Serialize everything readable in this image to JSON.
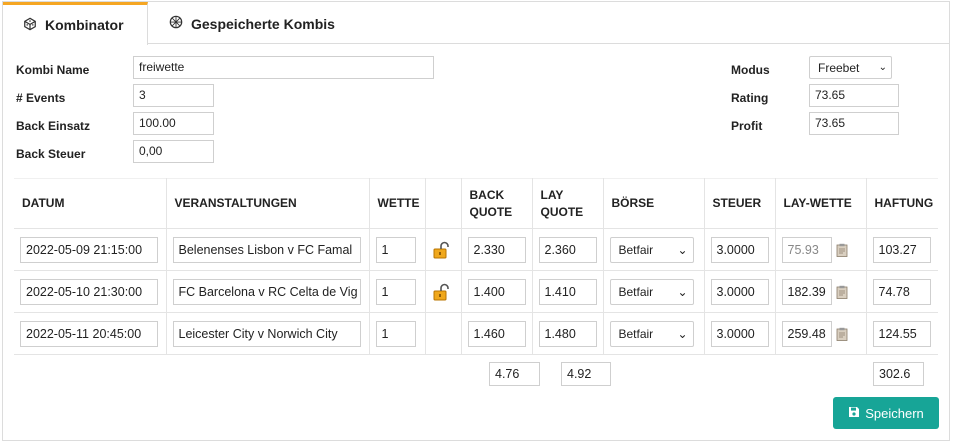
{
  "tabs": [
    {
      "label": "Kombinator",
      "icon": "dice-icon",
      "active": true
    },
    {
      "label": "Gespeicherte Kombis",
      "icon": "dice-icon",
      "active": false
    }
  ],
  "form": {
    "kombi_name": {
      "label": "Kombi Name",
      "value": "freiwette"
    },
    "events": {
      "label": "# Events",
      "value": "3"
    },
    "back_einsatz": {
      "label": "Back Einsatz",
      "value": "100.00"
    },
    "back_steuer": {
      "label": "Back Steuer",
      "value": "0,00"
    },
    "modus": {
      "label": "Modus",
      "value": "Freebet"
    },
    "rating": {
      "label": "Rating",
      "value": "73.65"
    },
    "profit": {
      "label": "Profit",
      "value": "73.65"
    }
  },
  "table": {
    "headers": {
      "datum": "DATUM",
      "veranstaltungen": "VERANSTALTUNGEN",
      "wette": "WETTE",
      "back_quote_1": "BACK",
      "back_quote_2": "QUOTE",
      "lay_quote_1": "LAY",
      "lay_quote_2": "QUOTE",
      "boerse": "BÖRSE",
      "steuer": "STEUER",
      "lay_wette": "LAY-WETTE",
      "haftung": "HAFTUNG"
    },
    "rows": [
      {
        "datum": "2022-05-09 21:15:00",
        "event": "Belenenses Lisbon v FC Famal",
        "wette": "1",
        "locked": true,
        "back": "2.330",
        "lay": "2.360",
        "boerse": "Betfair",
        "steuer": "3.0000",
        "lay_wette": "75.93",
        "lay_wette_muted": true,
        "haftung": "103.27"
      },
      {
        "datum": "2022-05-10 21:30:00",
        "event": "FC Barcelona v RC Celta de Vig",
        "wette": "1",
        "locked": true,
        "back": "1.400",
        "lay": "1.410",
        "boerse": "Betfair",
        "steuer": "3.0000",
        "lay_wette": "182.39",
        "lay_wette_muted": false,
        "haftung": "74.78"
      },
      {
        "datum": "2022-05-11 20:45:00",
        "event": "Leicester City v Norwich City",
        "wette": "1",
        "locked": false,
        "back": "1.460",
        "lay": "1.480",
        "boerse": "Betfair",
        "steuer": "3.0000",
        "lay_wette": "259.48",
        "lay_wette_muted": false,
        "haftung": "124.55"
      }
    ]
  },
  "totals": {
    "back": "4.76",
    "lay": "4.92",
    "haftung": "302.6"
  },
  "save_button": {
    "label": "Speichern"
  },
  "colors": {
    "accent_tab": "#f5a623",
    "save_button": "#17a597",
    "lock_icon": "#e8a10c"
  }
}
